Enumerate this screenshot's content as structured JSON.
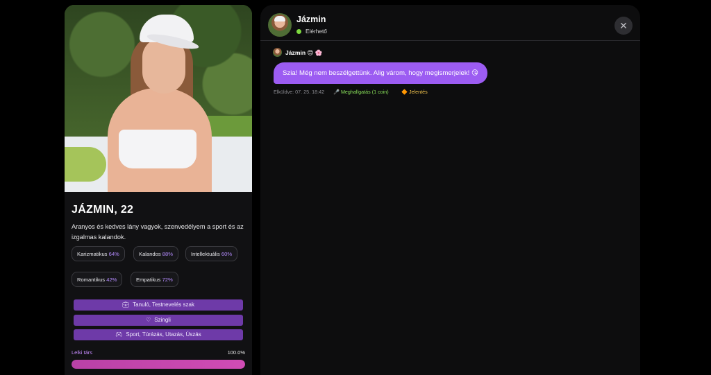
{
  "profile": {
    "name_age": "JÁZMIN, 22",
    "description": "Aranyos és kedves lány vagyok, szenvedélyem a sport és az izgalmas kalandok.",
    "traits": [
      {
        "label": "Karizmatikus",
        "percent": "64%"
      },
      {
        "label": "Kalandos",
        "percent": "88%"
      },
      {
        "label": "Intellektuális",
        "percent": "60%"
      },
      {
        "label": "Romantikus",
        "percent": "42%"
      },
      {
        "label": "Empatikus",
        "percent": "72%"
      }
    ],
    "tags": [
      {
        "icon": "briefcase-icon",
        "label": "Tanuló, Testnevelés szak"
      },
      {
        "icon": "heart-icon",
        "label": "Szingli"
      },
      {
        "icon": "gamepad-icon",
        "label": "Sport, Túrázás, Utazás, Úszás"
      }
    ],
    "soulmate_label": "Lelki társ",
    "soulmate_value": "100.0%",
    "soulmate_fraction": 1.0
  },
  "chat": {
    "name": "Jázmin",
    "status": "Elérhető",
    "status_color": "#7dd93f",
    "close_icon": "close-icon",
    "message": {
      "sender": "Jázmin 😊 🌸",
      "text": "Szia! Még nem beszélgettünk. Alig várom, hogy megismerjelek! 😘",
      "sent_label": "Elküldve: 07. 25. 18:42",
      "listen_label": "🎤 Meghallgatás (1 coin)",
      "report_label": "🔶 Jelentés"
    }
  },
  "colors": {
    "accent_purple": "#9c5cf2",
    "tag_purple": "#6e3aa8",
    "progress_pink": "#d14cb5"
  }
}
